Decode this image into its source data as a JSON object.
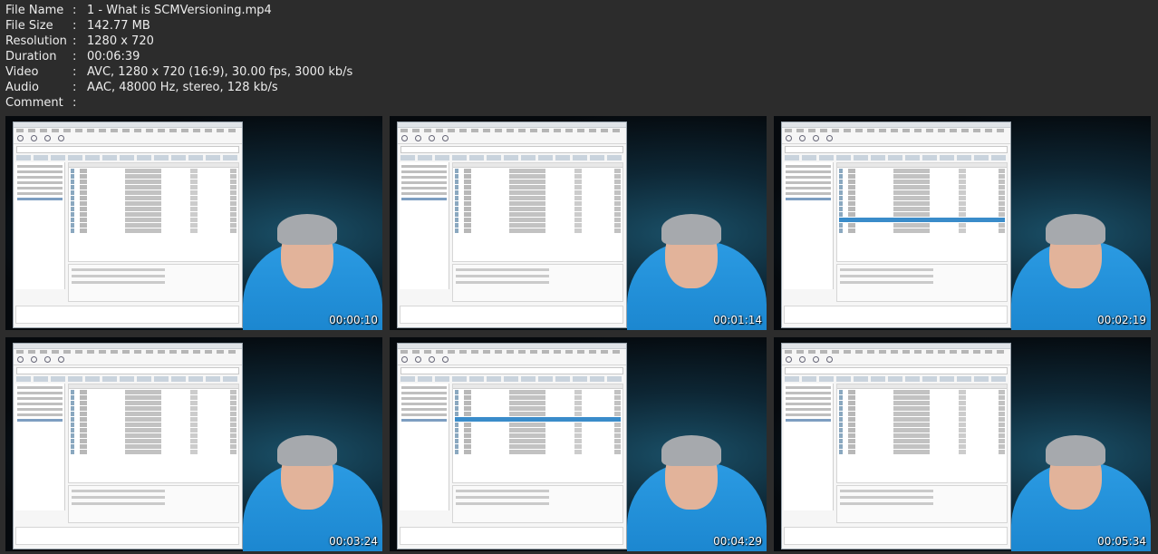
{
  "file_info": [
    {
      "key": "File Name",
      "sep": ":",
      "value": "1 - What is SCMVersioning.mp4"
    },
    {
      "key": "File Size",
      "sep": ":",
      "value": "142.77 MB"
    },
    {
      "key": "Resolution",
      "sep": ":",
      "value": "1280 x 720"
    },
    {
      "key": "Duration",
      "sep": ":",
      "value": "00:06:39"
    },
    {
      "key": "Video",
      "sep": ":",
      "value": "AVC, 1280 x 720 (16:9), 30.00 fps, 3000 kb/s"
    },
    {
      "key": "Audio",
      "sep": ":",
      "value": "AAC, 48000 Hz, stereo, 128 kb/s"
    },
    {
      "key": "Comment",
      "sep": ":",
      "value": ""
    }
  ],
  "thumbnails": [
    {
      "timestamp": "00:00:10",
      "selected_row": -1
    },
    {
      "timestamp": "00:01:14",
      "selected_row": -1
    },
    {
      "timestamp": "00:02:19",
      "selected_row": 9
    },
    {
      "timestamp": "00:03:24",
      "selected_row": -1
    },
    {
      "timestamp": "00:04:29",
      "selected_row": 5
    },
    {
      "timestamp": "00:05:34",
      "selected_row": -1
    }
  ],
  "colors": {
    "background": "#2c2c2c",
    "text": "#ececec",
    "shirt": "#2b9be3",
    "highlight_row": "#2f86c7"
  }
}
